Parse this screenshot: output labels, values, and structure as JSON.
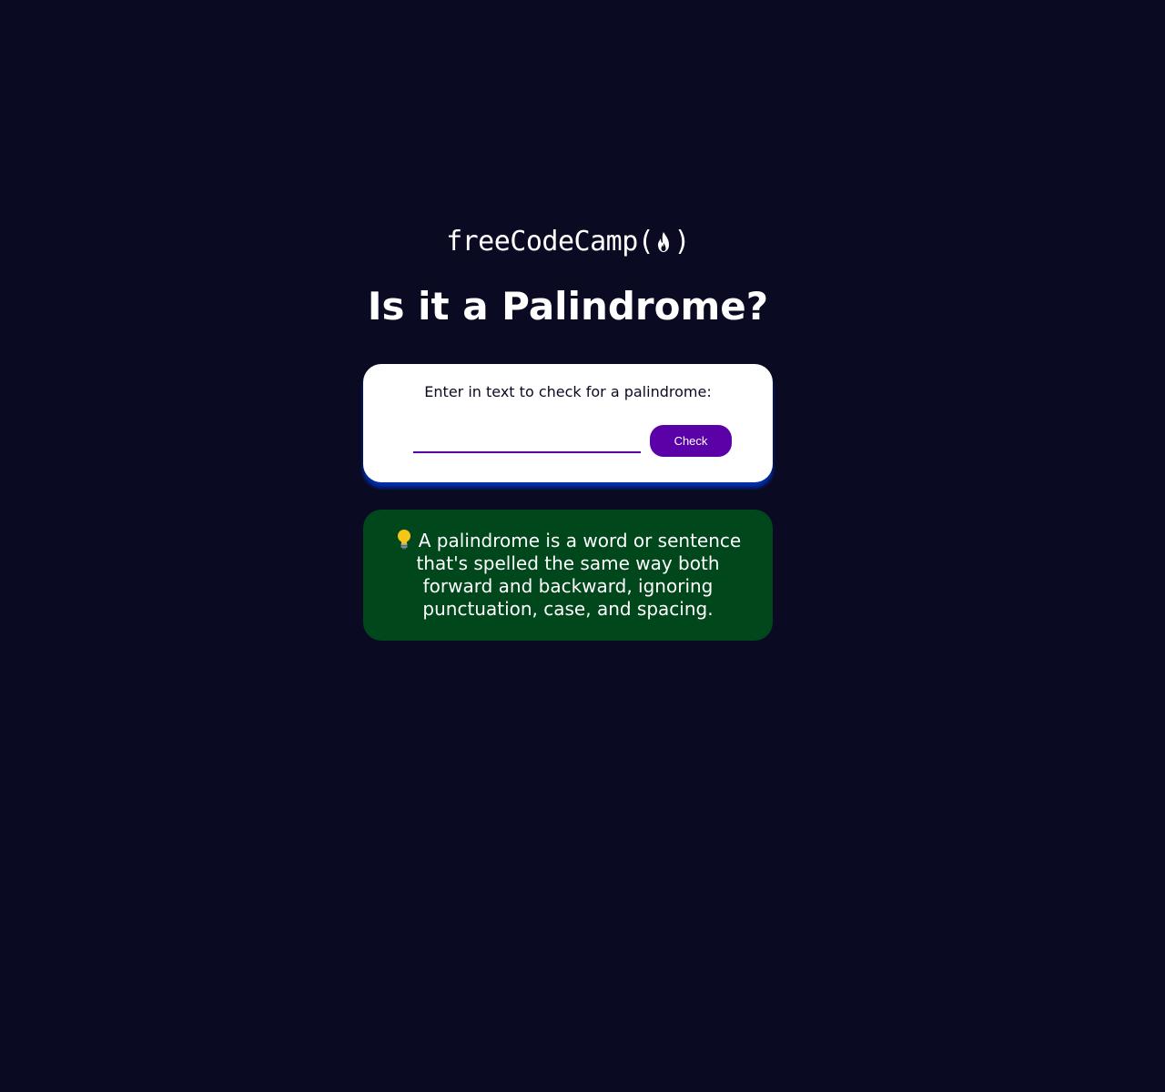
{
  "logo": {
    "prefix": "freeCodeCamp(",
    "suffix": ")",
    "icon": "flame-icon"
  },
  "page": {
    "title": "Is it a Palindrome?"
  },
  "input_card": {
    "label": "Enter in text to check for a palindrome:",
    "input_value": "",
    "input_placeholder": "",
    "button_label": "Check"
  },
  "info_card": {
    "icon": "lightbulb-icon",
    "text": "A palindrome is a word or sentence that's spelled the same way both forward and backward, ignoring punctuation, case, and spacing."
  },
  "colors": {
    "background": "#0a0a23",
    "button": "#5a01a7",
    "info_background": "#00471b",
    "card_shadow": "#002ead"
  }
}
